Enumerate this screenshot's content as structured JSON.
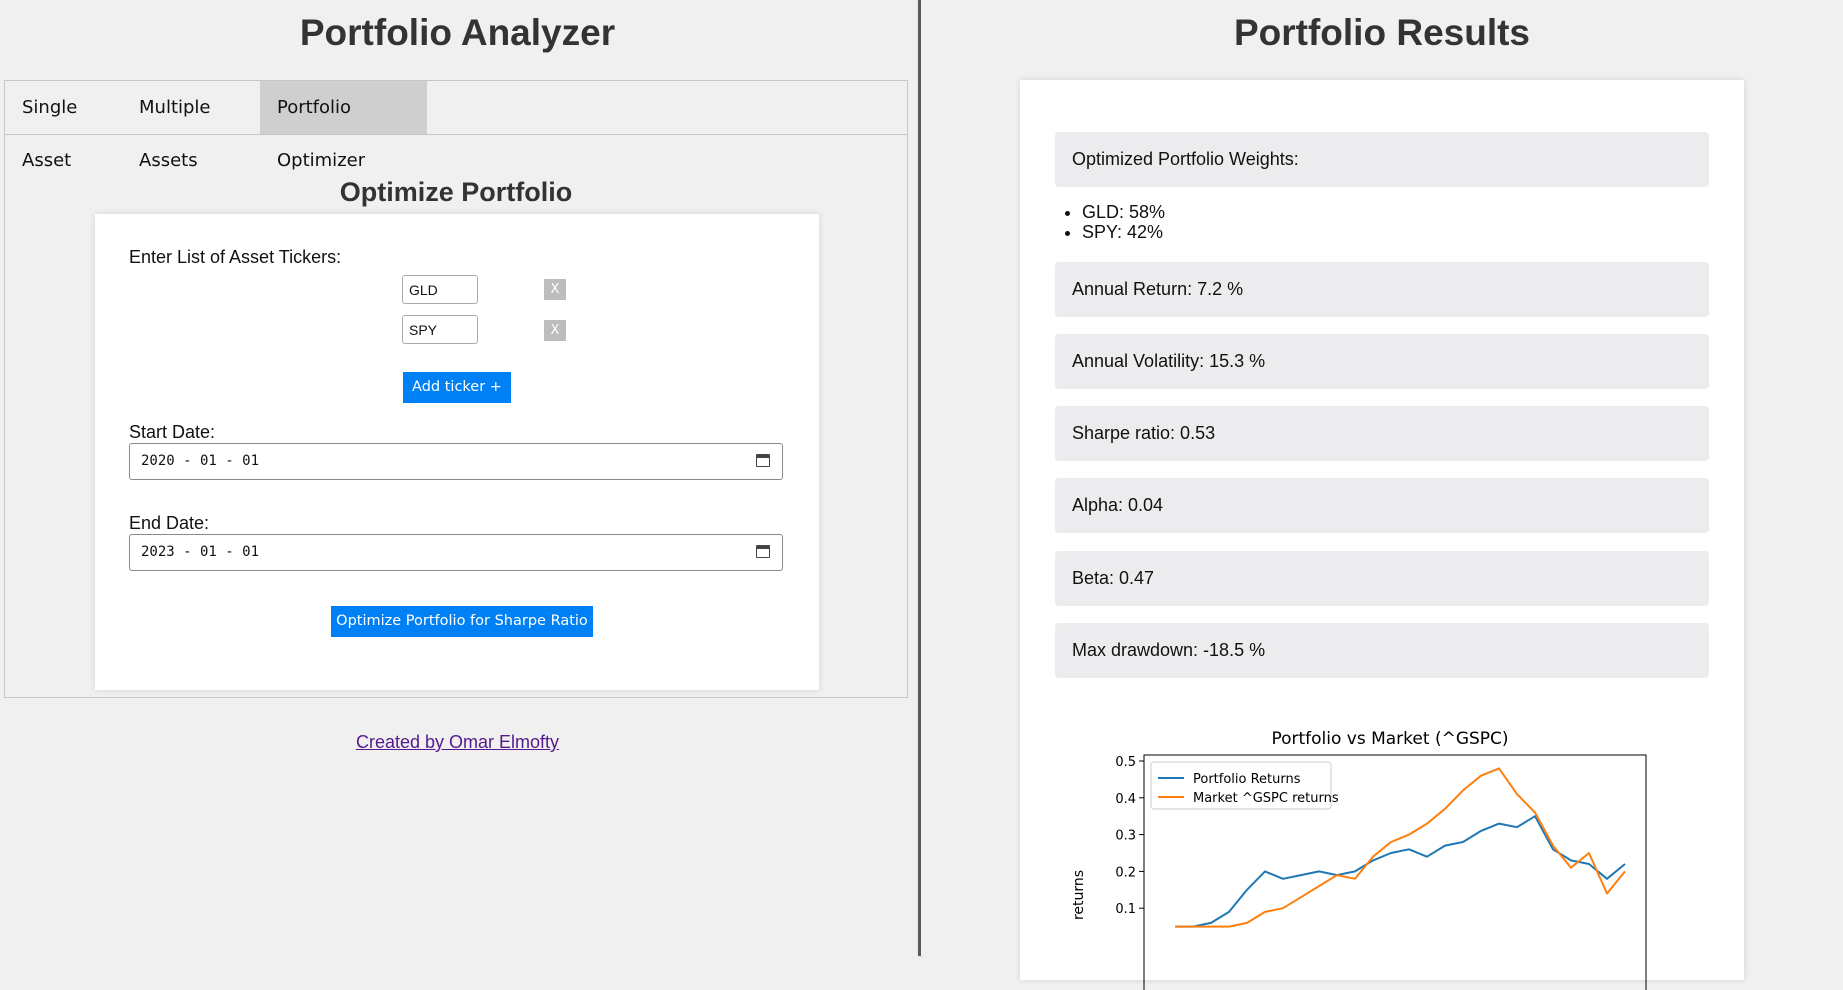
{
  "left": {
    "app_title": "Portfolio Analyzer",
    "tabs": [
      {
        "label": "Single Asset",
        "active": false
      },
      {
        "label": "Multiple Assets",
        "active": false
      },
      {
        "label": "Portfolio Optimizer",
        "active": true
      }
    ],
    "section_title": "Optimize Portfolio",
    "tickers_label": "Enter List of Asset Tickers:",
    "tickers": [
      "GLD",
      "SPY"
    ],
    "remove_label": "X",
    "add_ticker_label": "Add ticker +",
    "start_date_label": "Start Date:",
    "start_date": "2020 - 01 - 01",
    "end_date_label": "End Date:",
    "end_date": "2023 - 01 - 01",
    "optimize_button": "Optimize Portfolio for Sharpe Ratio",
    "footer_link": "Created by Omar Elmofty"
  },
  "right": {
    "results_title": "Portfolio Results",
    "weights_title": "Optimized Portfolio Weights:",
    "weights": [
      "GLD: 58%",
      "SPY: 42%"
    ],
    "annual_return": "Annual Return: 7.2 %",
    "annual_volatility": "Annual Volatility: 15.3 %",
    "sharpe_ratio": "Sharpe ratio: 0.53",
    "alpha": "Alpha: 0.04",
    "beta": "Beta: 0.47",
    "max_drawdown": "Max drawdown: -18.5 %"
  },
  "colors": {
    "accent": "#0080f5",
    "portfolio_line": "#1f77b4",
    "market_line": "#ff7f0e"
  },
  "chart_data": {
    "type": "line",
    "title": "Portfolio vs Market (^GSPC)",
    "ylabel": "returns",
    "y_ticks": [
      0.1,
      0.2,
      0.3,
      0.4,
      0.5
    ],
    "ylim": [
      0.05,
      0.52
    ],
    "x": [
      0,
      0.04,
      0.08,
      0.12,
      0.16,
      0.2,
      0.24,
      0.28,
      0.32,
      0.36,
      0.4,
      0.44,
      0.48,
      0.52,
      0.56,
      0.6,
      0.64,
      0.68,
      0.72,
      0.76,
      0.8,
      0.84,
      0.88,
      0.92,
      0.96,
      1.0
    ],
    "series": [
      {
        "name": "Portfolio Returns",
        "values": [
          0.05,
          0.05,
          0.06,
          0.09,
          0.15,
          0.2,
          0.18,
          0.19,
          0.2,
          0.19,
          0.2,
          0.23,
          0.25,
          0.26,
          0.24,
          0.27,
          0.28,
          0.31,
          0.33,
          0.32,
          0.35,
          0.26,
          0.23,
          0.22,
          0.18,
          0.22
        ]
      },
      {
        "name": "Market ^GSPC returns",
        "values": [
          0.05,
          0.05,
          0.05,
          0.05,
          0.06,
          0.09,
          0.1,
          0.13,
          0.16,
          0.19,
          0.18,
          0.24,
          0.28,
          0.3,
          0.33,
          0.37,
          0.42,
          0.46,
          0.48,
          0.41,
          0.36,
          0.27,
          0.21,
          0.25,
          0.14,
          0.2
        ]
      }
    ],
    "legend": "top-left"
  }
}
